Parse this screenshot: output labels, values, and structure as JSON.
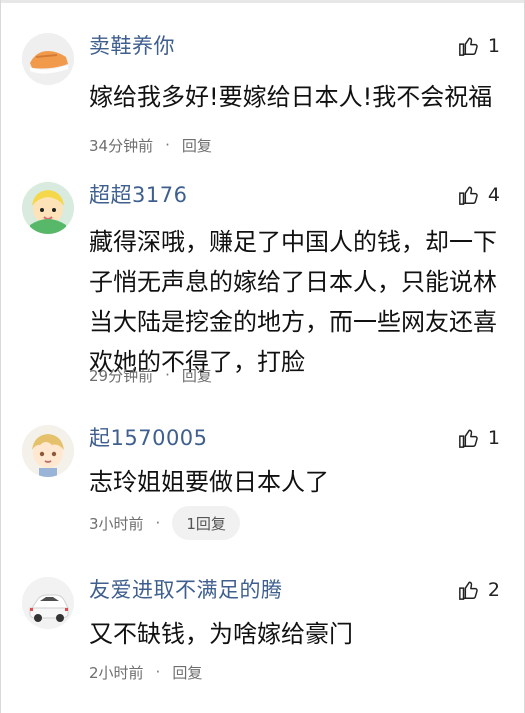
{
  "comments": [
    {
      "username": "卖鞋养你",
      "like_count": "1",
      "text": "嫁给我多好!要嫁给日本人!我不会祝福",
      "time": "34分钟前",
      "separator": "·",
      "reply_label": "回复"
    },
    {
      "username": "超超3176",
      "like_count": "4",
      "text": "藏得深哦，赚足了中国人的钱，却一下子悄无声息的嫁给了日本人，只能说林当大陆是挖金的地方，而一些网友还喜欢她的不得了，打脸",
      "time": "29分钟前",
      "separator": "·",
      "reply_label": "回复"
    },
    {
      "username": "起1570005",
      "like_count": "1",
      "text": "志玲姐姐要做日本人了",
      "time": "3小时前",
      "separator": "·",
      "reply_label": "1回复"
    },
    {
      "username": "友爱进取不满足的腾",
      "like_count": "2",
      "text": "又不缺钱，为啥嫁给豪门",
      "time": "2小时前",
      "separator": "·",
      "reply_label": "回复"
    }
  ],
  "icons": {
    "like": "thumbs-up-icon"
  },
  "colors": {
    "username": "#3f5f8f",
    "text": "#111111",
    "meta": "#6f6f6f",
    "reply_pill_bg": "#f1f1f1"
  }
}
